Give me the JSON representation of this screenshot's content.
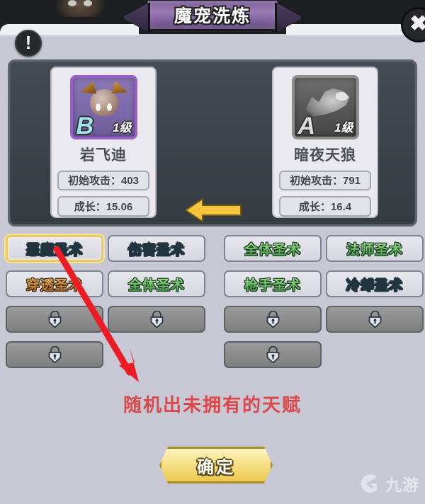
{
  "window": {
    "title": "魔宠洗炼",
    "warning_icon": "exclamation-icon",
    "close_icon": "close-icon"
  },
  "compare": {
    "transfer_arrow_icon": "arrow-left-icon",
    "pets": [
      {
        "side": "left",
        "name": "岩飞迪",
        "grade": "B",
        "level": "1级",
        "stats": [
          {
            "label_value": "初始攻击：403"
          },
          {
            "label_value": "成长：15.06"
          }
        ]
      },
      {
        "side": "right",
        "name": "暗夜天狼",
        "grade": "A",
        "level": "1级",
        "stats": [
          {
            "label_value": "初始攻击：791"
          },
          {
            "label_value": "成长：16.4"
          }
        ]
      }
    ]
  },
  "skills": {
    "rows": [
      [
        {
          "label": "恶魔圣术",
          "color": "blue",
          "state": "selected"
        },
        {
          "label": "伤害圣术",
          "color": "blue",
          "state": "known"
        },
        {
          "label": "全体圣术",
          "color": "green",
          "state": "known"
        },
        {
          "label": "法师圣术",
          "color": "green",
          "state": "known"
        }
      ],
      [
        {
          "label": "穿透圣术",
          "color": "orange",
          "state": "known"
        },
        {
          "label": "全体圣术",
          "color": "green",
          "state": "known"
        },
        {
          "label": "枪手圣术",
          "color": "green",
          "state": "known"
        },
        {
          "label": "冷却圣术",
          "color": "blue",
          "state": "known"
        }
      ],
      [
        {
          "label": "",
          "state": "locked",
          "icon": "lock-icon"
        },
        {
          "label": "",
          "state": "locked",
          "icon": "lock-icon"
        },
        {
          "label": "",
          "state": "locked",
          "icon": "lock-icon"
        },
        {
          "label": "",
          "state": "locked",
          "icon": "lock-icon"
        }
      ],
      [
        {
          "label": "",
          "state": "locked",
          "icon": "lock-icon"
        },
        {
          "label": "",
          "state": "empty"
        },
        {
          "label": "",
          "state": "locked",
          "icon": "lock-icon"
        },
        {
          "label": "",
          "state": "empty"
        }
      ]
    ]
  },
  "annotation": {
    "text": "随机出未拥有的天赋",
    "color": "#e03a3a",
    "arrow_icon": "red-arrow-icon"
  },
  "footer": {
    "confirm_label": "确定"
  },
  "watermark": {
    "text": "九游",
    "logo_icon": "jiuyou-logo-icon"
  }
}
